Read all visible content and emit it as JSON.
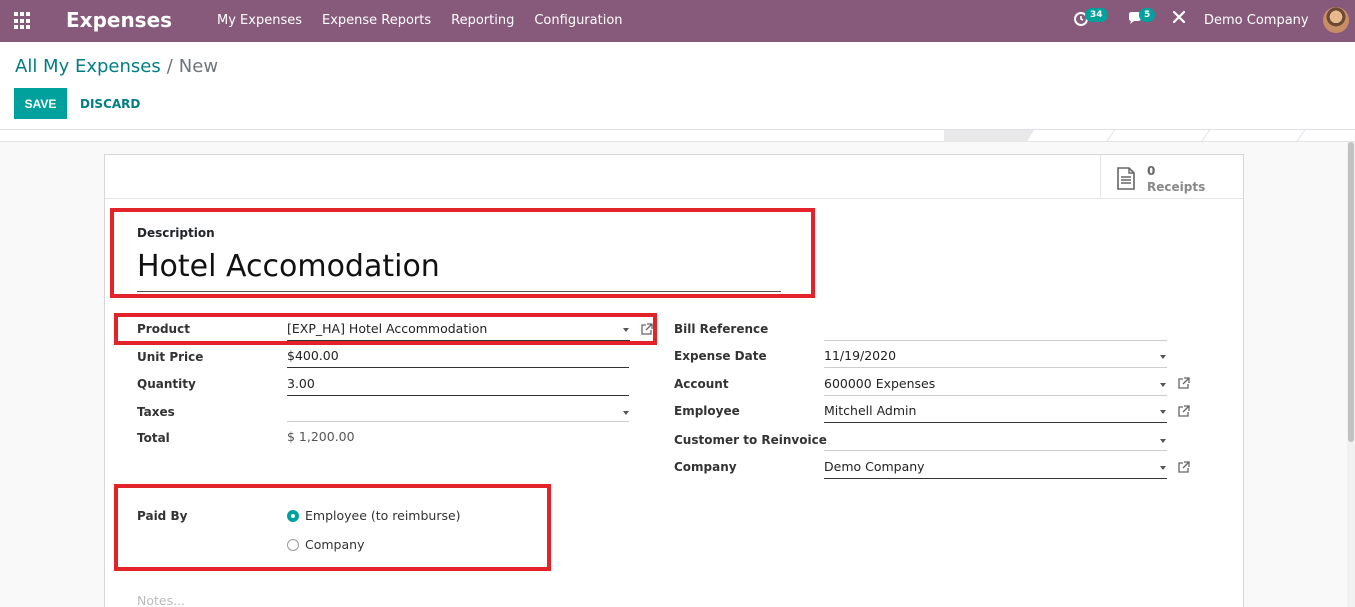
{
  "navbar": {
    "app_title": "Expenses",
    "menu": [
      "My Expenses",
      "Expense Reports",
      "Reporting",
      "Configuration"
    ],
    "activity_count": "34",
    "messages_count": "5",
    "company": "Demo Company",
    "icons": {
      "apps": "apps-grid-icon",
      "activity": "clock-icon",
      "messages": "chat-icon",
      "debug": "tools-icon"
    }
  },
  "breadcrumb": {
    "parent": "All My Expenses",
    "separator": "/",
    "current": "New"
  },
  "actions": {
    "save": "SAVE",
    "discard": "DISCARD"
  },
  "smart_button": {
    "count": "0",
    "label": "Receipts",
    "icon": "document-icon"
  },
  "form": {
    "description_label": "Description",
    "description_value": "Hotel Accomodation",
    "left": {
      "product_label": "Product",
      "product_value": "[EXP_HA] Hotel Accommodation",
      "unit_price_label": "Unit Price",
      "unit_price_value": "$400.00",
      "quantity_label": "Quantity",
      "quantity_value": "3.00",
      "taxes_label": "Taxes",
      "taxes_value": "",
      "total_label": "Total",
      "total_value": "$ 1,200.00"
    },
    "right": {
      "bill_reference_label": "Bill Reference",
      "bill_reference_value": "",
      "expense_date_label": "Expense Date",
      "expense_date_value": "11/19/2020",
      "account_label": "Account",
      "account_value": "600000 Expenses",
      "employee_label": "Employee",
      "employee_value": "Mitchell Admin",
      "customer_label": "Customer to Reinvoice",
      "customer_value": "",
      "company_label": "Company",
      "company_value": "Demo Company"
    },
    "paid_by": {
      "label": "Paid By",
      "options": [
        "Employee (to reimburse)",
        "Company"
      ],
      "selected": "Employee (to reimburse)"
    },
    "notes_placeholder": "Notes..."
  },
  "colors": {
    "navbar": "#875a7b",
    "accent": "#00a09d",
    "link": "#017e84",
    "highlight": "#e2232a"
  }
}
